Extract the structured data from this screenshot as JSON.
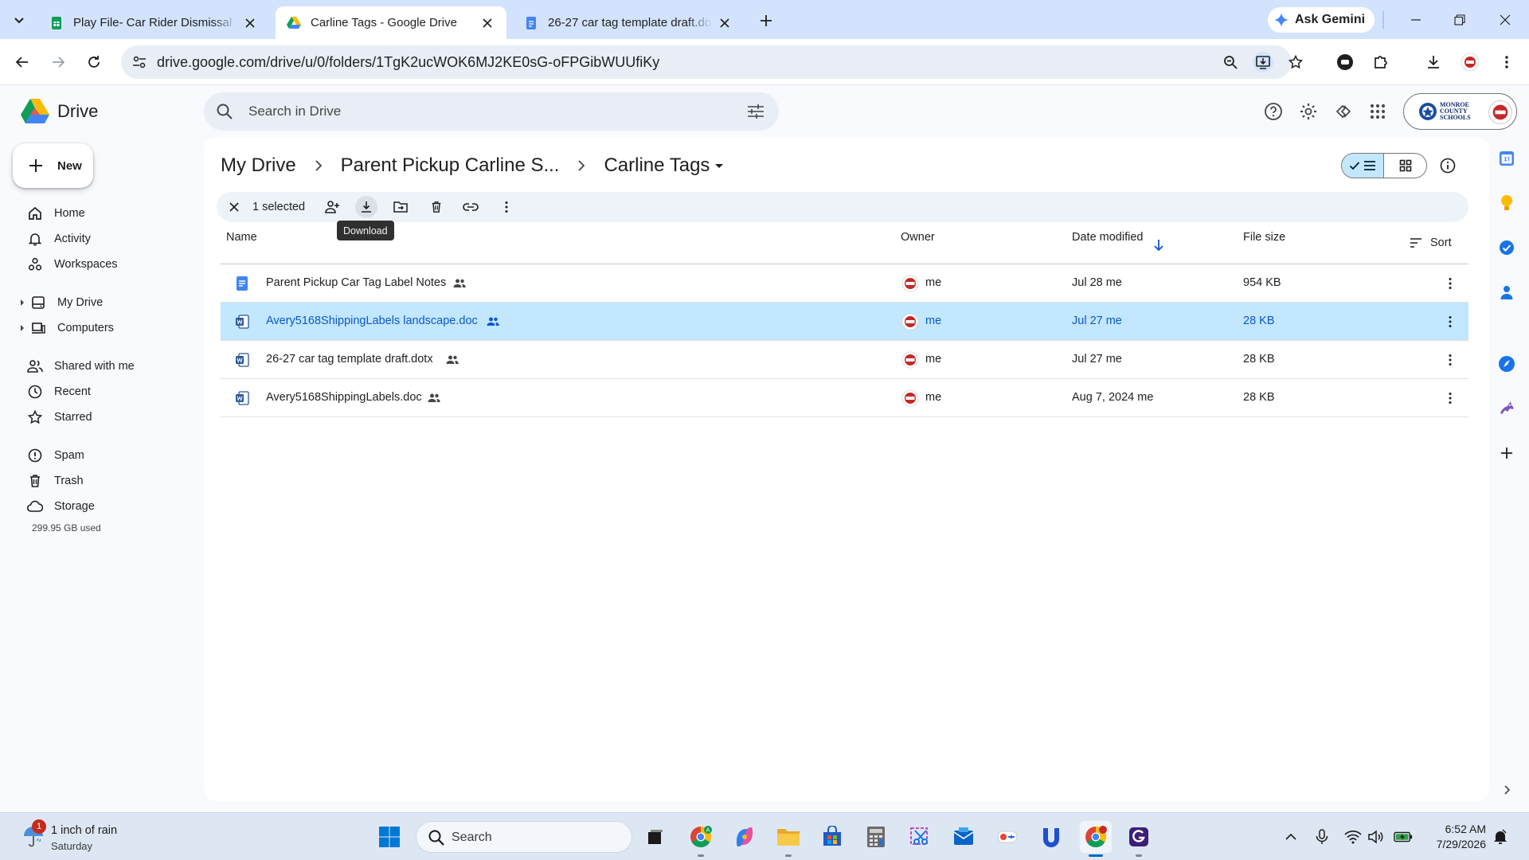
{
  "browser": {
    "tabs": [
      {
        "title": "Play File- Car Rider Dismissal - F",
        "favicon": "google-sheets-icon",
        "active": false
      },
      {
        "title": "Carline Tags - Google Drive",
        "favicon": "google-drive-icon",
        "active": true
      },
      {
        "title": "26-27 car tag template draft.do",
        "favicon": "google-docs-icon",
        "active": false
      }
    ],
    "ask_gemini": "Ask Gemini",
    "url": "drive.google.com/drive/u/0/folders/1TgK2ucWOK6MJ2KE0sG-oFPGibWUUfiKy"
  },
  "drive": {
    "app_name": "Drive",
    "search_placeholder": "Search in Drive",
    "new_label": "New",
    "nav": [
      {
        "label": "Home",
        "icon": "home-icon"
      },
      {
        "label": "Activity",
        "icon": "bell-icon"
      },
      {
        "label": "Workspaces",
        "icon": "workspaces-icon"
      },
      {
        "label": "My Drive",
        "icon": "my-drive-icon"
      },
      {
        "label": "Computers",
        "icon": "computer-icon"
      },
      {
        "label": "Shared with me",
        "icon": "people-icon"
      },
      {
        "label": "Recent",
        "icon": "clock-icon"
      },
      {
        "label": "Starred",
        "icon": "star-icon"
      },
      {
        "label": "Spam",
        "icon": "spam-icon"
      },
      {
        "label": "Trash",
        "icon": "trash-icon"
      },
      {
        "label": "Storage",
        "icon": "cloud-icon"
      }
    ],
    "storage_used": "299.95 GB used",
    "breadcrumb": [
      "My Drive",
      "Parent Pickup Carline S...",
      "Carline Tags"
    ],
    "selection": {
      "count_label": "1 selected",
      "tooltip": "Download"
    },
    "columns": {
      "name": "Name",
      "owner": "Owner",
      "modified": "Date modified",
      "size": "File size",
      "sort": "Sort"
    },
    "files": [
      {
        "name": "Parent Pickup Car Tag Label Notes",
        "type": "google-doc-icon",
        "shared": true,
        "owner": "me",
        "modified": "Jul 28 me",
        "size": "954 KB",
        "selected": false
      },
      {
        "name": "Avery5168ShippingLabels landscape.doc",
        "type": "word-doc-icon",
        "shared": true,
        "owner": "me",
        "modified": "Jul 27 me",
        "size": "28 KB",
        "selected": true
      },
      {
        "name": "26-27 car tag template draft.dotx",
        "type": "word-doc-icon",
        "shared": true,
        "owner": "me",
        "modified": "Jul 27 me",
        "size": "28 KB",
        "selected": false
      },
      {
        "name": "Avery5168ShippingLabels.doc",
        "type": "word-doc-icon",
        "shared": true,
        "owner": "me",
        "modified": "Aug 7, 2024 me",
        "size": "28 KB",
        "selected": false
      }
    ],
    "account_logo_text": [
      "MONROE",
      "COUNTY",
      "SCHOOLS"
    ]
  },
  "taskbar": {
    "weather_line1": "1 inch of rain",
    "weather_line2": "Saturday",
    "weather_badge": "1",
    "search_label": "Search",
    "time": "6:52 AM",
    "date": "7/29/2026"
  },
  "colors": {
    "selected_row": "#c2e7ff",
    "accent": "#0b57d0",
    "tabstrip": "#d3e3fd"
  }
}
